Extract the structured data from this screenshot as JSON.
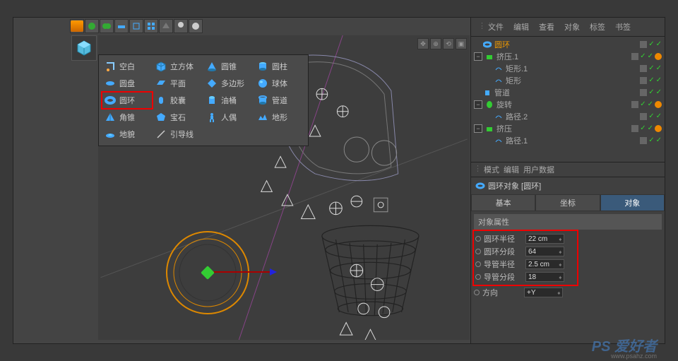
{
  "toolbar": {
    "cube": "cube"
  },
  "primitives": {
    "rows": [
      [
        {
          "label": "空白",
          "icon": "null",
          "col": 0
        },
        {
          "label": "立方体",
          "icon": "cube",
          "col": 1
        },
        {
          "label": "圆锥",
          "icon": "cone",
          "col": 2
        },
        {
          "label": "圆柱",
          "icon": "cylinder",
          "col": 3
        }
      ],
      [
        {
          "label": "圆盘",
          "icon": "disc",
          "col": 0
        },
        {
          "label": "平面",
          "icon": "plane",
          "col": 1
        },
        {
          "label": "多边形",
          "icon": "polygon",
          "col": 2
        },
        {
          "label": "球体",
          "icon": "sphere",
          "col": 3
        }
      ],
      [
        {
          "label": "圆环",
          "icon": "torus",
          "col": 0
        },
        {
          "label": "胶囊",
          "icon": "capsule",
          "col": 1
        },
        {
          "label": "油桶",
          "icon": "oiltank",
          "col": 2
        },
        {
          "label": "管道",
          "icon": "tube",
          "col": 3
        }
      ],
      [
        {
          "label": "角锥",
          "icon": "pyramid",
          "col": 0
        },
        {
          "label": "宝石",
          "icon": "platonic",
          "col": 1
        },
        {
          "label": "人偶",
          "icon": "figure",
          "col": 2
        },
        {
          "label": "地形",
          "icon": "landscape",
          "col": 3
        }
      ],
      [
        {
          "label": "地貌",
          "icon": "relief",
          "col": 0
        },
        {
          "label": "引导线",
          "icon": "guide",
          "col": 1
        }
      ]
    ],
    "highlighted": "圆环"
  },
  "object_menu": {
    "tabs": [
      "文件",
      "编辑",
      "查看",
      "对象",
      "标签",
      "书签"
    ]
  },
  "tree": [
    {
      "indent": 0,
      "toggle": "",
      "icon": "torus",
      "label": "圆环",
      "active": true,
      "tags": [
        "gray",
        "check",
        "check"
      ]
    },
    {
      "indent": 0,
      "toggle": "-",
      "icon": "extrude",
      "label": "挤压.1",
      "tags": [
        "gray",
        "check",
        "check",
        "dot"
      ]
    },
    {
      "indent": 1,
      "toggle": "",
      "icon": "rect",
      "label": "矩形.1",
      "tags": [
        "gray",
        "check",
        "check"
      ]
    },
    {
      "indent": 1,
      "toggle": "",
      "icon": "rect",
      "label": "矩形",
      "tags": [
        "gray",
        "check",
        "check"
      ]
    },
    {
      "indent": 0,
      "toggle": "",
      "icon": "tube",
      "label": "管道",
      "tags": [
        "gray",
        "check",
        "check"
      ]
    },
    {
      "indent": 0,
      "toggle": "-",
      "icon": "lathe",
      "label": "旋转",
      "tags": [
        "gray",
        "check",
        "check",
        "dot"
      ]
    },
    {
      "indent": 1,
      "toggle": "",
      "icon": "spline",
      "label": "路径.2",
      "tags": [
        "gray",
        "check",
        "check"
      ]
    },
    {
      "indent": 0,
      "toggle": "-",
      "icon": "extrude",
      "label": "挤压",
      "tags": [
        "gray",
        "check",
        "check",
        "dot"
      ]
    },
    {
      "indent": 1,
      "toggle": "",
      "icon": "spline",
      "label": "路径.1",
      "tags": [
        "gray",
        "check",
        "check"
      ]
    }
  ],
  "attr_menu": {
    "tabs": [
      "模式",
      "编辑",
      "用户数据"
    ]
  },
  "object_title": "圆环对象 [圆环]",
  "sub_tabs": {
    "items": [
      "基本",
      "坐标",
      "对象"
    ],
    "active": "对象"
  },
  "props": {
    "header": "对象属性",
    "rows": [
      {
        "label": "圆环半径",
        "value": "22 cm"
      },
      {
        "label": "圆环分段",
        "value": "64"
      },
      {
        "label": "导管半径",
        "value": "2.5 cm"
      },
      {
        "label": "导管分段",
        "value": "18"
      }
    ],
    "orientation": {
      "label": "方向",
      "value": "+Y"
    }
  },
  "watermark": {
    "main": "PS 爱好者",
    "sub": "www.psahz.com"
  }
}
